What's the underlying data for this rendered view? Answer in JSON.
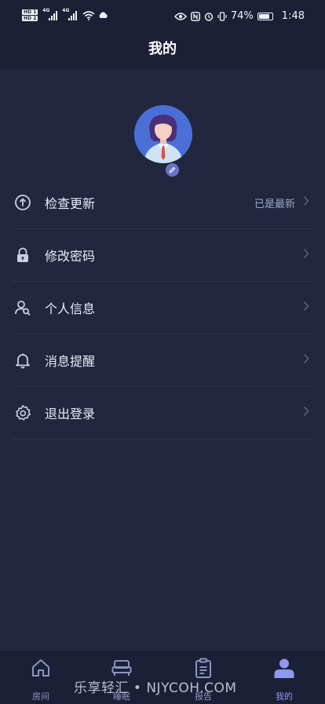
{
  "status_bar": {
    "hd1": "HD 1",
    "hd2": "HD 2",
    "net1": "4G",
    "net2": "4G",
    "battery": "74%",
    "time": "1:48"
  },
  "header": {
    "title": "我的"
  },
  "profile": {
    "avatar_icon": "avatar-illustration",
    "edit_icon": "pencil-icon"
  },
  "menu": [
    {
      "label": "检查更新",
      "value": "已是最新",
      "icon": "upload-circle-icon"
    },
    {
      "label": "修改密码",
      "value": "",
      "icon": "lock-icon"
    },
    {
      "label": "个人信息",
      "value": "",
      "icon": "user-search-icon"
    },
    {
      "label": "消息提醒",
      "value": "",
      "icon": "bell-icon"
    },
    {
      "label": "退出登录",
      "value": "",
      "icon": "gear-icon"
    }
  ],
  "tabs": [
    {
      "label": "房间",
      "icon": "home-icon",
      "active": false
    },
    {
      "label": "睡眠",
      "icon": "bed-icon",
      "active": false
    },
    {
      "label": "报告",
      "icon": "clipboard-icon",
      "active": false
    },
    {
      "label": "我的",
      "icon": "person-icon",
      "active": true
    }
  ],
  "watermark": "乐享轻汇 • NJYCOH.COM",
  "colors": {
    "background": "#22273f",
    "bar": "#1c2036",
    "accent": "#8f98ea",
    "icon": "#c9cde6"
  }
}
